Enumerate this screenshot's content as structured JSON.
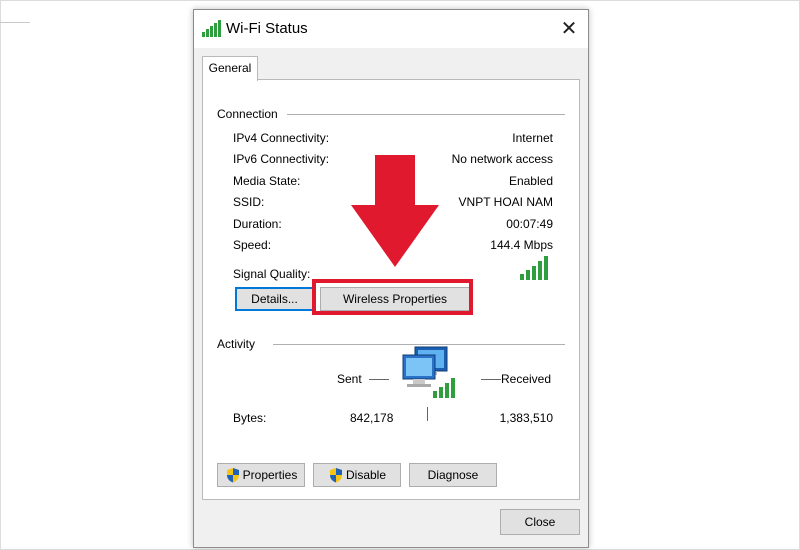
{
  "window": {
    "title": "Wi-Fi Status",
    "close_glyph": "✕",
    "icon": "wifi-signal-icon"
  },
  "tabs": [
    {
      "label": "General",
      "active": true
    }
  ],
  "connection": {
    "heading": "Connection",
    "rows": [
      {
        "label": "IPv4 Connectivity:",
        "value": "Internet"
      },
      {
        "label": "IPv6 Connectivity:",
        "value": "No network access"
      },
      {
        "label": "Media State:",
        "value": "Enabled"
      },
      {
        "label": "SSID:",
        "value": "VNPT HOAI NAM"
      },
      {
        "label": "Duration:",
        "value": "00:07:49"
      },
      {
        "label": "Speed:",
        "value": "144.4 Mbps"
      }
    ],
    "signal_label": "Signal Quality:",
    "signal_bars": 5,
    "details_button": "Details...",
    "wireless_button": "Wireless Properties"
  },
  "activity": {
    "heading": "Activity",
    "sent_label": "Sent",
    "received_label": "Received",
    "bytes_label": "Bytes:",
    "sent_bytes": "842,178",
    "received_bytes": "1,383,510"
  },
  "buttons": {
    "properties": "Properties",
    "disable": "Disable",
    "diagnose": "Diagnose",
    "close": "Close"
  },
  "colors": {
    "accent": "#0078d7",
    "highlight": "#e0192e",
    "signal": "#2e9e3e"
  }
}
